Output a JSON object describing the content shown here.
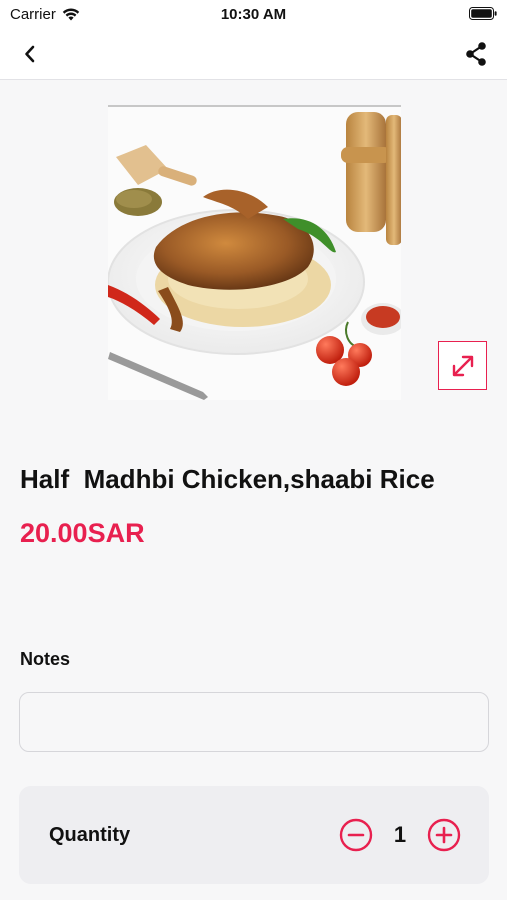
{
  "status_bar": {
    "carrier": "Carrier",
    "time": "10:30 AM"
  },
  "nav": {
    "back_icon": "chevron-left-icon",
    "share_icon": "share-icon"
  },
  "product": {
    "title": "Half  Madhbi Chicken,shaabi Rice",
    "price": "20.00SAR",
    "image_icon": "product-photo",
    "expand_icon": "expand-icon"
  },
  "notes": {
    "label": "Notes",
    "value": "",
    "placeholder": ""
  },
  "quantity": {
    "label": "Quantity",
    "value": "1",
    "minus_icon": "minus-circle-icon",
    "plus_icon": "plus-circle-icon"
  },
  "colors": {
    "accent": "#e8204f",
    "background": "#f7f7f8",
    "card": "#eeeef1"
  }
}
